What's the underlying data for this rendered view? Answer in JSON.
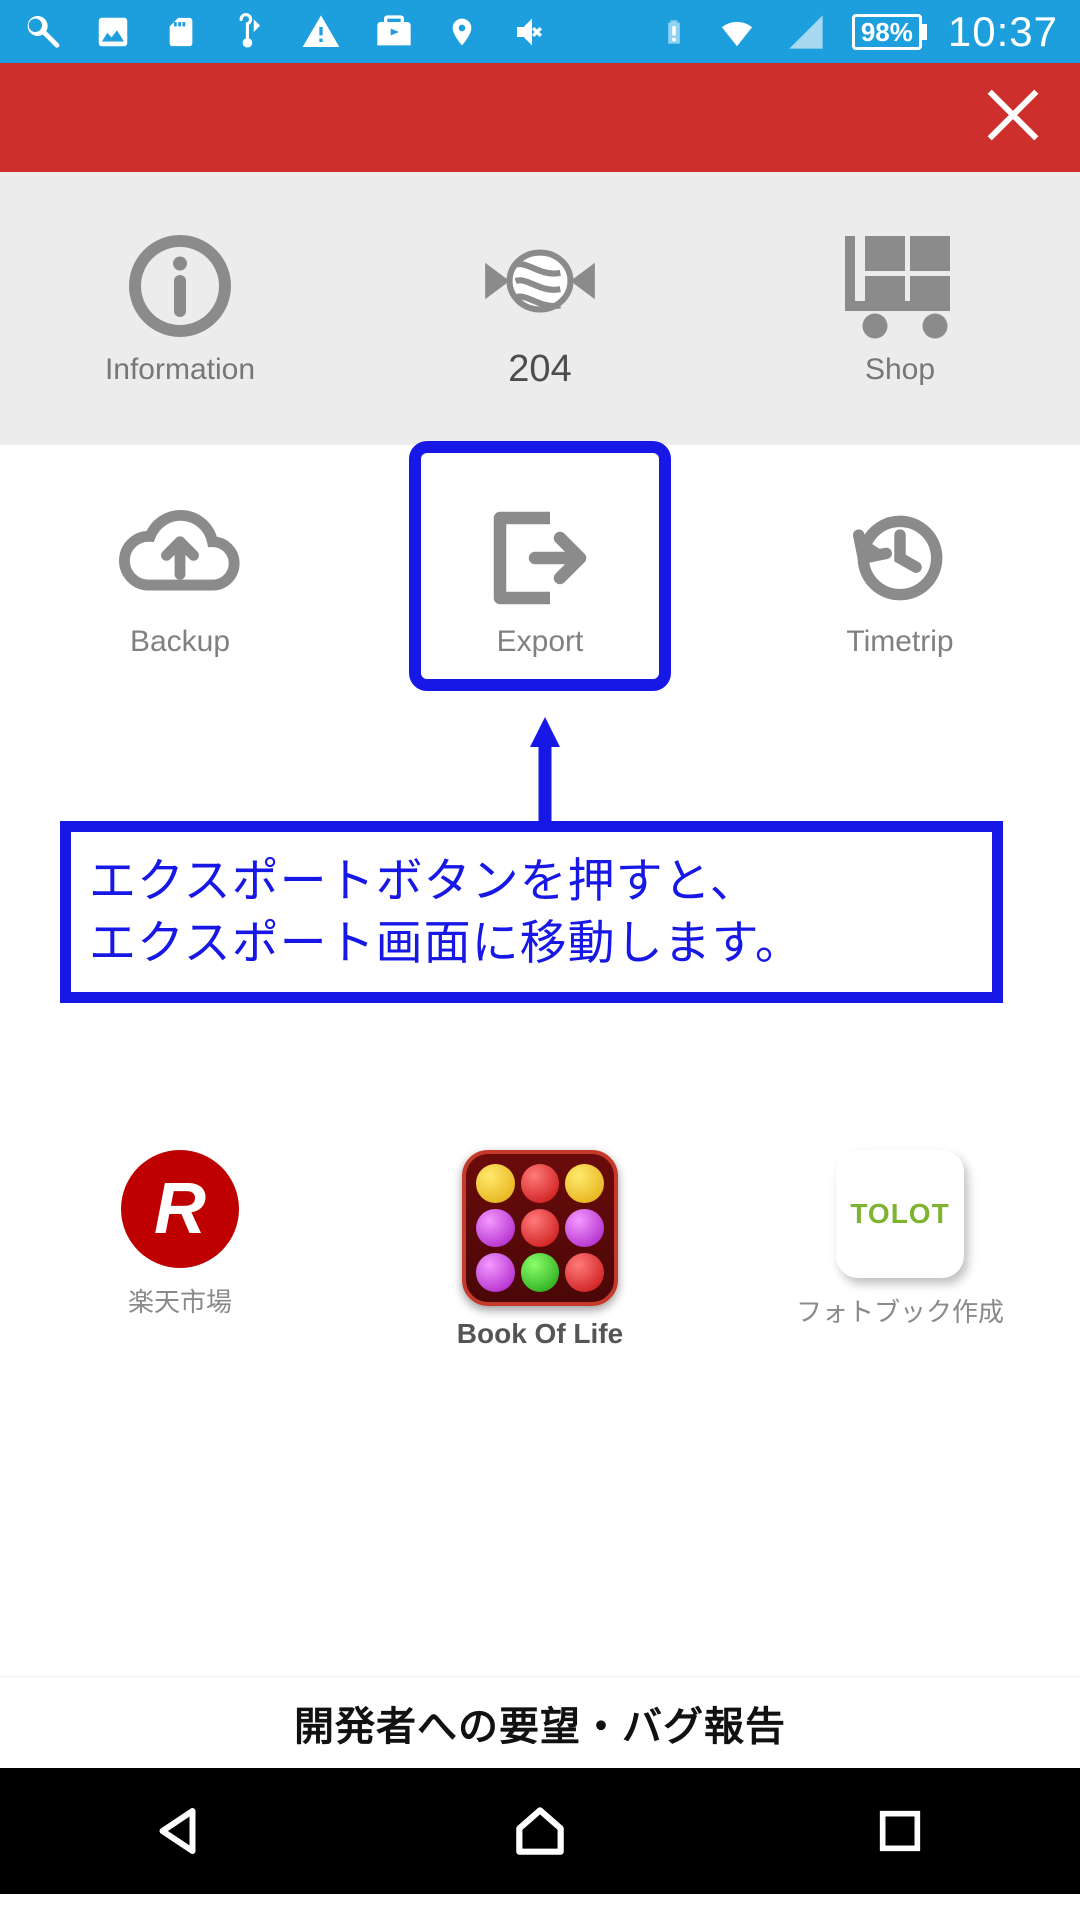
{
  "status": {
    "battery": "98%",
    "time": "10:37"
  },
  "row1": {
    "info": "Information",
    "candy": "204",
    "shop": "Shop"
  },
  "row2": {
    "backup": "Backup",
    "export": "Export",
    "timetrip": "Timetrip"
  },
  "annotation": {
    "line1": "エクスポートボタンを押すと、",
    "line2": "エクスポート画面に移動します。"
  },
  "promo": {
    "rakuten_initial": "R",
    "rakuten": "楽天市場",
    "bol": "Book Of Life",
    "tolot_brand": "TOLOT",
    "tolot": "フォトブック作成"
  },
  "feedback": "開発者への要望・バグ報告"
}
